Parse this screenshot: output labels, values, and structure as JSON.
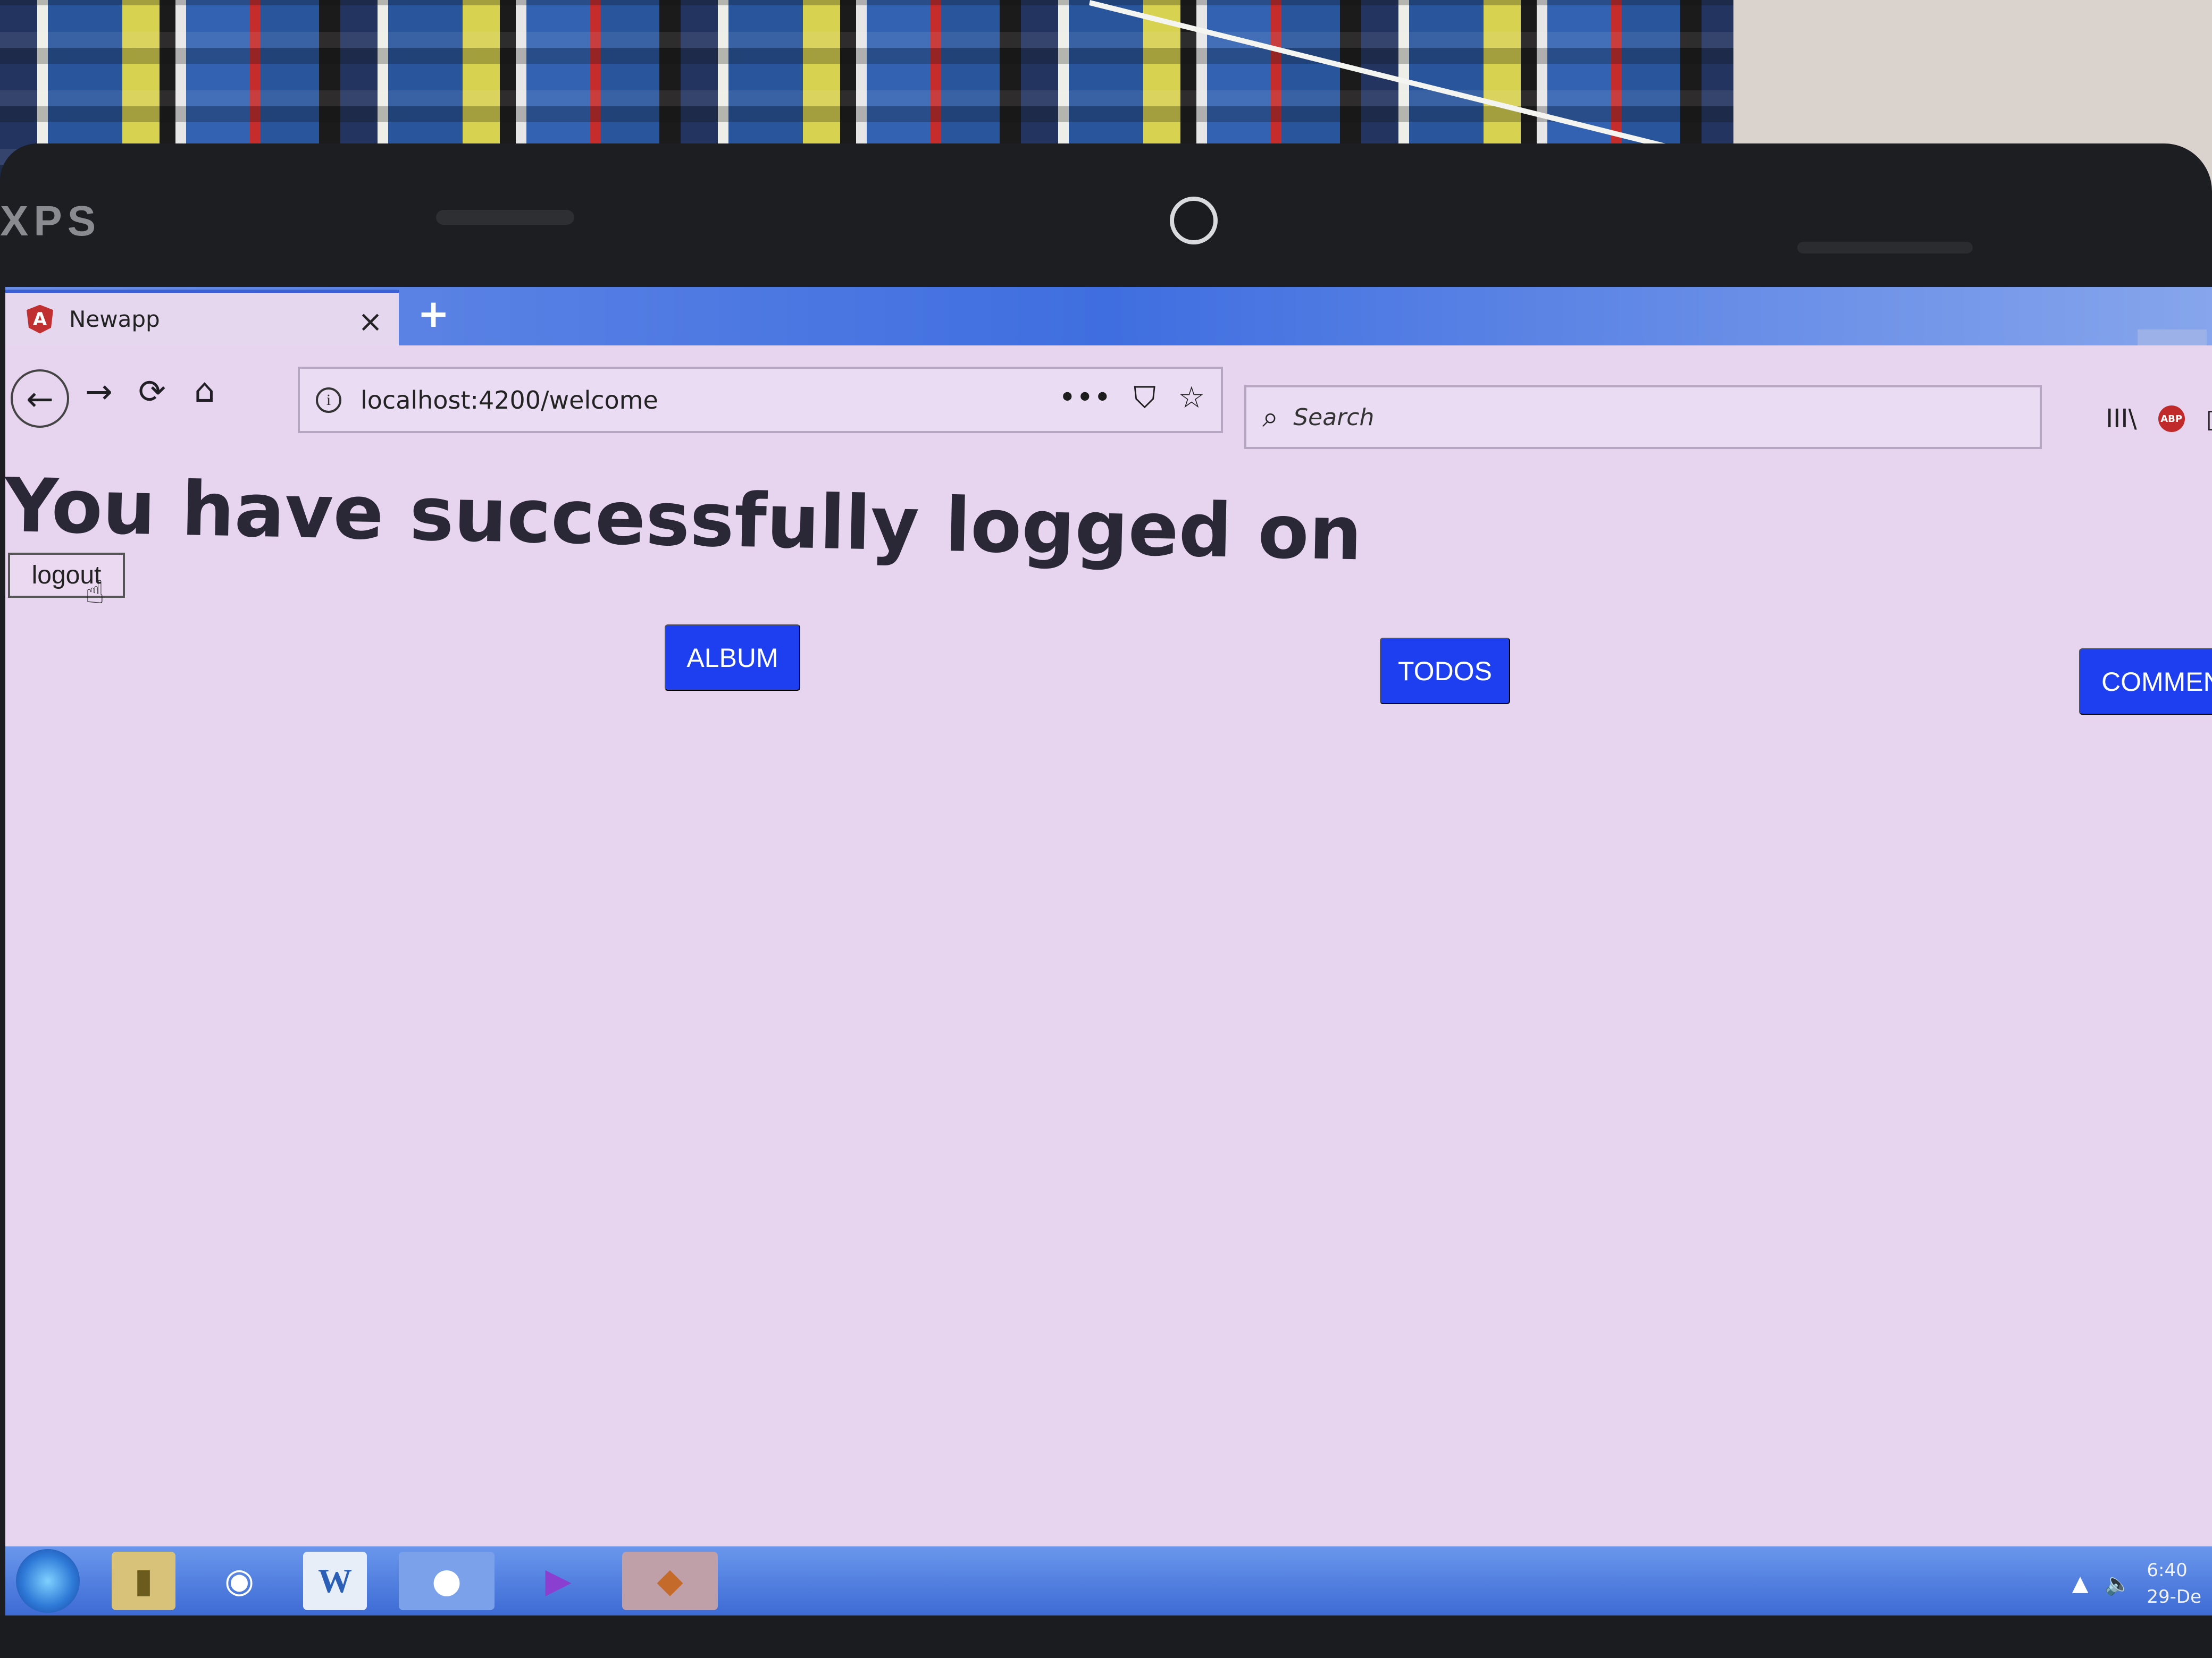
{
  "device": {
    "brand_label": "XPS"
  },
  "browser": {
    "tab": {
      "title": "Newapp",
      "logo_letter": "A",
      "close_glyph": "×"
    },
    "new_tab_glyph": "+",
    "nav": {
      "back_glyph": "←",
      "forward_glyph": "→",
      "reload_glyph": "⟳",
      "home_glyph": "⌂"
    },
    "url": {
      "info_glyph": "i",
      "value": "localhost:4200/welcome",
      "more_glyph": "•••",
      "pocket_glyph": "⛉",
      "bookmark_glyph": "☆"
    },
    "search": {
      "glyph": "⌕",
      "placeholder": "Search"
    },
    "toolbar": {
      "library_glyph": "III\\",
      "abp_label": "ABP",
      "sidebar_glyph": "▯"
    }
  },
  "page": {
    "heading": "You have successfully logged on",
    "logout_label": "logout",
    "buttons": {
      "album": "ALBUM",
      "todos": "TODOS",
      "comments": "COMMEN"
    },
    "colors": {
      "primary_button": "#1e3ff0",
      "page_background": "#e7d4ef"
    }
  },
  "taskbar": {
    "icons": [
      "windows-start-icon",
      "file-explorer-icon",
      "paint-icon",
      "word-icon",
      "firefox-icon",
      "visual-studio-icon",
      "vscode-icon"
    ],
    "word_glyph": "W",
    "tray": {
      "arrow_glyph": "▲",
      "volume_glyph": "🔈",
      "time": "6:40",
      "date": "29-De"
    }
  }
}
